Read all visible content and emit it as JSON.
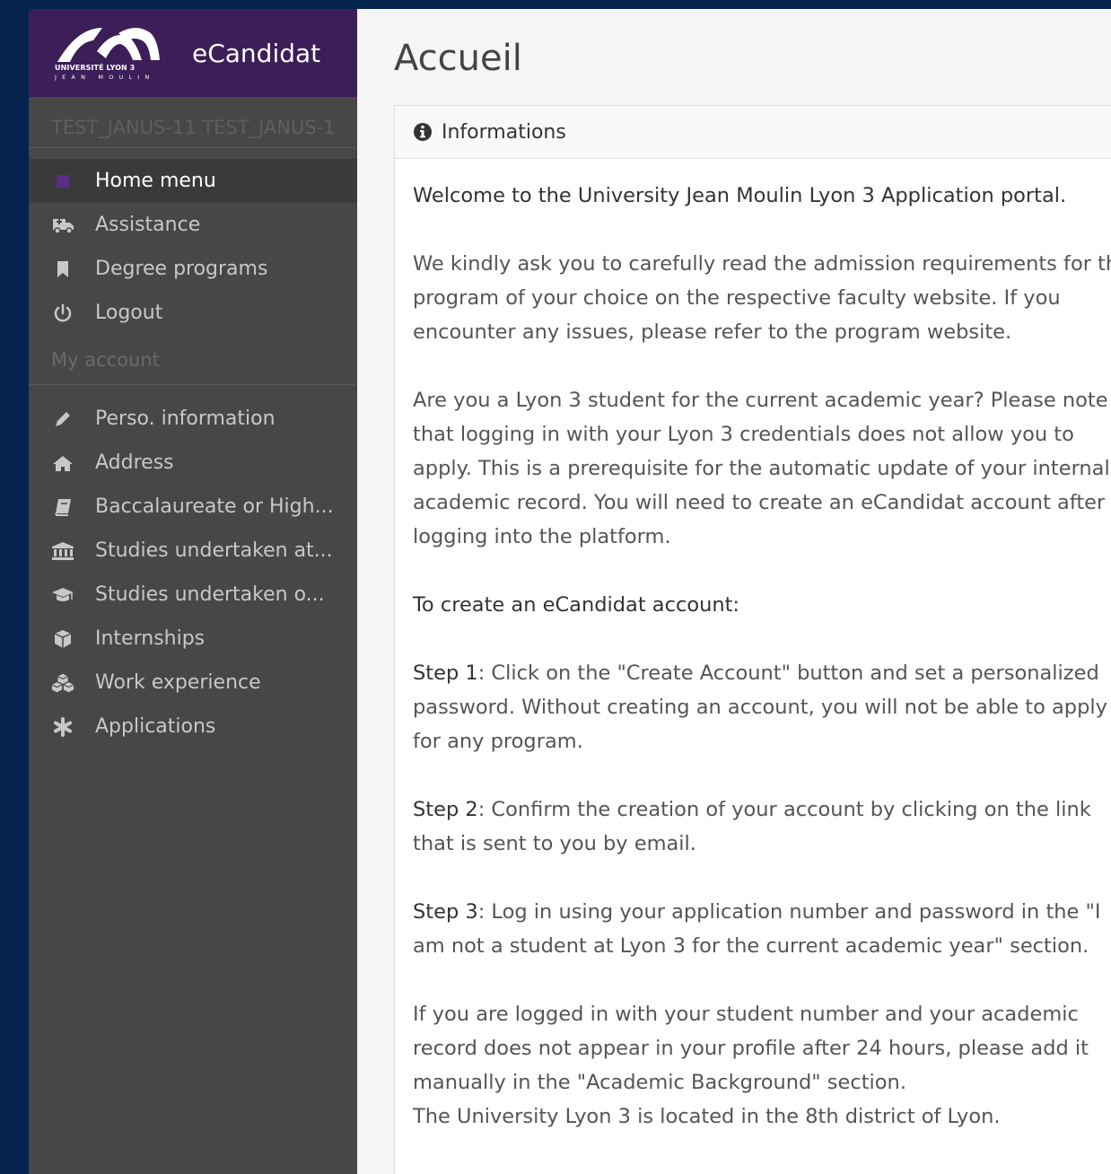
{
  "brand": {
    "logo_line1": "UNIVERSITÉ LYON 3",
    "logo_line2": "JEAN MOULIN",
    "app_name": "eCandidat"
  },
  "sidebar": {
    "user": "TEST_JANUS-11 TEST_JANUS-1",
    "top_items": [
      {
        "label": "Home menu",
        "icon": "home-icon"
      },
      {
        "label": "Assistance",
        "icon": "ambulance-icon"
      },
      {
        "label": "Degree programs",
        "icon": "bookmark-icon"
      },
      {
        "label": "Logout",
        "icon": "power-icon"
      }
    ],
    "account_label": "My account",
    "account_items": [
      {
        "label": "Perso. information",
        "icon": "pencil-icon"
      },
      {
        "label": "Address",
        "icon": "house-icon"
      },
      {
        "label": "Baccalaureate or High...",
        "icon": "book-icon"
      },
      {
        "label": "Studies undertaken at...",
        "icon": "university-icon"
      },
      {
        "label": "Studies undertaken o...",
        "icon": "graduation-cap-icon"
      },
      {
        "label": "Internships",
        "icon": "cube-icon"
      },
      {
        "label": "Work experience",
        "icon": "cubes-icon"
      },
      {
        "label": "Applications",
        "icon": "asterisk-icon"
      }
    ]
  },
  "main": {
    "title": "Accueil",
    "panel_title": "Informations",
    "welcome": "Welcome to the University Jean Moulin Lyon 3 Application portal.",
    "para1": [
      "We kindly ask you to carefully read the admission requirements for the",
      "program of your choice on the respective faculty website. If you",
      "encounter any issues, please refer to the program website."
    ],
    "para2": [
      "Are you a Lyon 3 student for the current academic year? Please note",
      "that logging in with your Lyon 3 credentials does not allow you to",
      "apply. This is a prerequisite for the automatic update of your internal",
      "academic record. You will need to create an eCandidat account after",
      "logging into the platform."
    ],
    "create_heading": "To create an eCandidat account:",
    "step1_label": "Step 1",
    "step1": [
      ": Click on the \"Create Account\" button and set a personalized",
      "password. Without creating an account, you will not be able to apply",
      "for any program."
    ],
    "step2_label": "Step 2",
    "step2": [
      ": Confirm the creation of your account by clicking on the link",
      "that is sent to you by email."
    ],
    "step3_label": "Step 3",
    "step3": [
      ": Log in using your application number and password in the \"I",
      "am not a student at Lyon 3 for the current academic year\" section."
    ],
    "para3": [
      "If you are logged in with your student number and your academic",
      "record does not appear in your profile after 24 hours, please add it",
      "manually in the \"Academic Background\" section.",
      "The University Lyon 3 is located in the 8th district of Lyon."
    ]
  },
  "colors": {
    "brand_bg": "#3c1e58",
    "sidebar_bg": "#474747",
    "page_bg": "#05234f",
    "active_icon": "#5b2d86"
  }
}
